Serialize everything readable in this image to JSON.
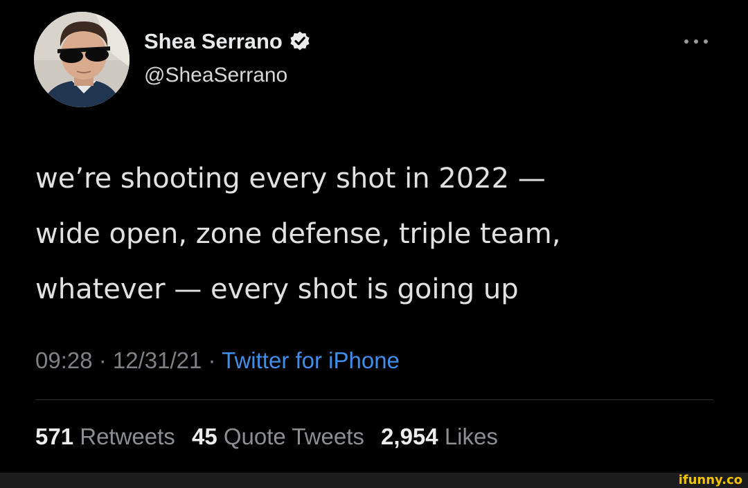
{
  "author": {
    "display_name": "Shea Serrano",
    "handle": "@SheaSerrano",
    "verified_icon": "verified-badge-icon",
    "avatar": "profile-photo"
  },
  "menu": {
    "more_icon": "more-options-icon"
  },
  "tweet": {
    "lines": [
      "we’re shooting every shot in 2022 —",
      "wide open, zone defense, triple team,",
      "whatever — every shot is going up"
    ],
    "time": "09:28",
    "separator": " · ",
    "date": "12/31/21",
    "source": "Twitter for iPhone"
  },
  "stats": {
    "retweets": {
      "count": "571",
      "label": "Retweets"
    },
    "quote_tweets": {
      "count": "45",
      "label": "Quote Tweets"
    },
    "likes": {
      "count": "2,954",
      "label": "Likes"
    }
  },
  "watermark": "ifunny.co",
  "colors": {
    "background": "#000000",
    "link": "#3f8ee8",
    "muted": "#7e8186",
    "watermark": "#f2c200"
  }
}
